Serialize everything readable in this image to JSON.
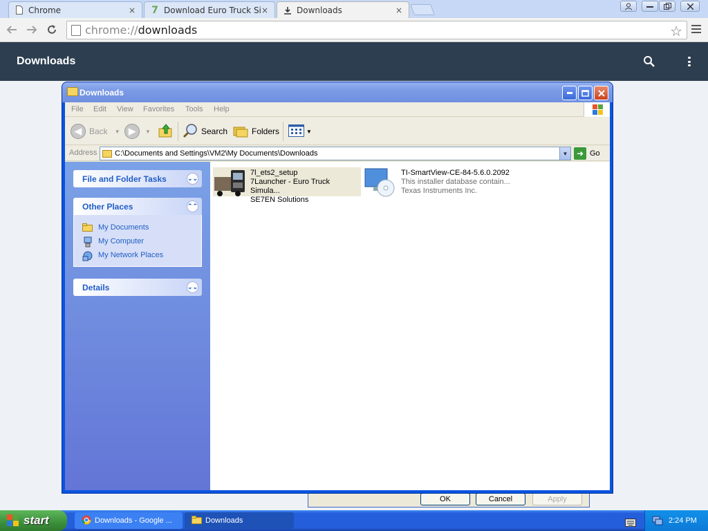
{
  "chrome": {
    "tabs": [
      {
        "title": "Chrome",
        "close": "×"
      },
      {
        "title": "Download Euro Truck Simulat",
        "close": "×"
      },
      {
        "title": "Downloads",
        "close": "×"
      }
    ],
    "url_scheme": "chrome://",
    "url_path": "downloads",
    "page_title": "Downloads"
  },
  "explorer": {
    "title": "Downloads",
    "menu": [
      "File",
      "Edit",
      "View",
      "Favorites",
      "Tools",
      "Help"
    ],
    "toolbar": {
      "back": "Back",
      "search": "Search",
      "folders": "Folders"
    },
    "address_label": "Address",
    "address_path": "C:\\Documents and Settings\\VM2\\My Documents\\Downloads",
    "go_label": "Go",
    "taskpane": {
      "file_folder_tasks": "File and Folder Tasks",
      "other_places": "Other Places",
      "places": [
        "My Documents",
        "My Computer",
        "My Network Places"
      ],
      "details": "Details"
    },
    "files": [
      {
        "name": "7l_ets2_setup",
        "desc": "7Launcher - Euro Truck Simula...",
        "company": "SE7EN Solutions"
      },
      {
        "name": "TI-SmartView-CE-84-5.6.0.2092",
        "desc": "This installer database contain...",
        "company": "Texas Instruments Inc."
      }
    ]
  },
  "background_dialog": {
    "buttons": [
      "OK",
      "Cancel",
      "Apply"
    ]
  },
  "taskbar": {
    "start_label": "start",
    "tasks": [
      "Downloads - Google ...",
      "Downloads"
    ],
    "clock": "2:24 PM"
  },
  "colors": {
    "chrome_header": "#2c3e50",
    "xp_blue": "#245edb",
    "taskpane_link": "#215dc6"
  }
}
